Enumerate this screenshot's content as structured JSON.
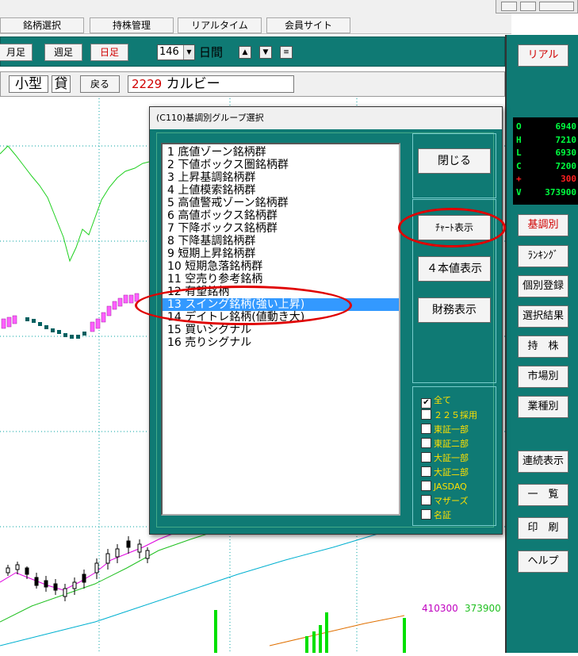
{
  "menu": {
    "items": [
      "銘柄選択",
      "持株管理",
      "リアルタイム",
      "会員サイト"
    ]
  },
  "toolbar": {
    "monthly": "月足",
    "weekly": "週足",
    "daily": "日足",
    "days_value": "146",
    "days_unit": "日間",
    "up_arrow": "▲",
    "down_arrow": "▼",
    "menu_glyph": "≡"
  },
  "stockbar": {
    "size": "小型",
    "loan": "貸",
    "back": "戻る",
    "code": "2229",
    "name": "カルビー"
  },
  "sidebar": {
    "real": "リアル",
    "ohlc": [
      {
        "k": "O",
        "v": "6940",
        "color": "#00ff40"
      },
      {
        "k": "H",
        "v": "7210",
        "color": "#00ff40"
      },
      {
        "k": "L",
        "v": "6930",
        "color": "#00ff40"
      },
      {
        "k": "C",
        "v": "7200",
        "color": "#00ff40"
      },
      {
        "k": "+",
        "v": "300",
        "color": "#ff2020"
      },
      {
        "k": "V",
        "v": "373900",
        "color": "#00ff40"
      }
    ],
    "buttons": [
      "基調別",
      "ﾗﾝｷﾝｸﾞ",
      "個別登録",
      "選択結果",
      "持　株",
      "市場別",
      "業種別",
      "連続表示",
      "一　覧",
      "印　刷",
      "ヘルプ"
    ]
  },
  "dialog": {
    "title": "(C110)基調別グループ選択",
    "close": "閉じる",
    "chart_show": "ﾁｬｰﾄ表示",
    "four_values": "４本値表示",
    "financial": "財務表示",
    "groups": [
      "1  底値ゾーン銘柄群",
      "2  下値ボックス圏銘柄群",
      "3  上昇基調銘柄群",
      "4  上値模索銘柄群",
      "5  高値警戒ゾーン銘柄群",
      "6  高値ボックス銘柄群",
      "7  下降ボックス銘柄群",
      "8  下降基調銘柄群",
      "9  短期上昇銘柄群",
      "10 短期急落銘柄群",
      "11 空売り参考銘柄",
      "12 有望銘柄",
      "13 スイング銘柄(強い上昇)",
      "14 デイトレ銘柄(値動き大)",
      "15 買いシグナル",
      "16 売りシグナル"
    ],
    "selected_index": 12,
    "markets": [
      {
        "label": "全て",
        "checked": true
      },
      {
        "label": "２２５採用",
        "checked": false
      },
      {
        "label": "東証一部",
        "checked": false
      },
      {
        "label": "東証二部",
        "checked": false
      },
      {
        "label": "大証一部",
        "checked": false
      },
      {
        "label": "大証二部",
        "checked": false
      },
      {
        "label": "JASDAQ",
        "checked": false
      },
      {
        "label": "マザーズ",
        "checked": false
      },
      {
        "label": "名証",
        "checked": false
      }
    ]
  },
  "chart": {
    "labels": [
      "410300",
      "373900"
    ],
    "label_colors": [
      "#c000c0",
      "#20c020"
    ]
  },
  "colors": {
    "teal": "#0f7a74",
    "selection": "#3399ff",
    "highlight": "#e00000"
  }
}
